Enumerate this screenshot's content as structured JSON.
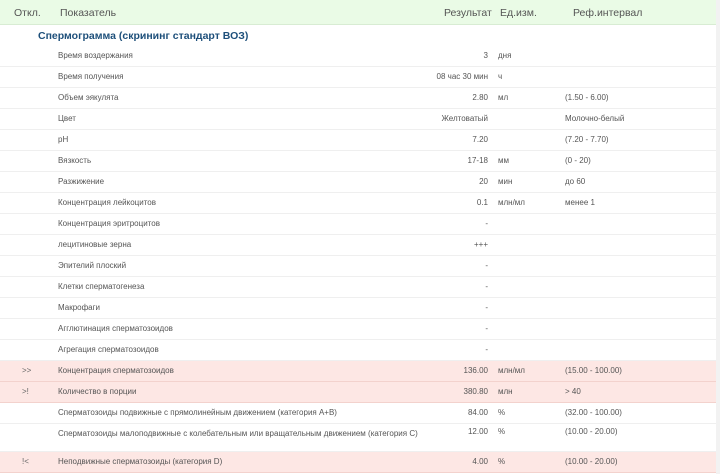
{
  "header": {
    "flag": "Откл.",
    "name": "Показатель",
    "result": "Результат",
    "unit": "Ед.изм.",
    "ref": "Реф.интервал"
  },
  "section_title": "Спермограмма (скрининг стандарт ВОЗ)",
  "rows": [
    {
      "flag": "",
      "name": "Время воздержания",
      "value": "3",
      "unit": "дня",
      "ref": ""
    },
    {
      "flag": "",
      "name": "Время получения",
      "value": "08 час 30 мин",
      "unit": "ч",
      "ref": ""
    },
    {
      "flag": "",
      "name": "Объем эякулята",
      "value": "2.80",
      "unit": "мл",
      "ref": "(1.50 - 6.00)"
    },
    {
      "flag": "",
      "name": "Цвет",
      "value": "Желтоватый",
      "unit": "",
      "ref": "Молочно-белый"
    },
    {
      "flag": "",
      "name": "pH",
      "value": "7.20",
      "unit": "",
      "ref": "(7.20 - 7.70)"
    },
    {
      "flag": "",
      "name": "Вязкость",
      "value": "17-18",
      "unit": "мм",
      "ref": "(0 - 20)"
    },
    {
      "flag": "",
      "name": "Разжижение",
      "value": "20",
      "unit": "мин",
      "ref": "до 60"
    },
    {
      "flag": "",
      "name": "Концентрация лейкоцитов",
      "value": "0.1",
      "unit": "млн/мл",
      "ref": "менее 1"
    },
    {
      "flag": "",
      "name": "Концентрация эритроцитов",
      "value": "-",
      "unit": "",
      "ref": ""
    },
    {
      "flag": "",
      "name": "лецитиновые зерна",
      "value": "+++",
      "unit": "",
      "ref": ""
    },
    {
      "flag": "",
      "name": "Эпителий плоский",
      "value": "-",
      "unit": "",
      "ref": ""
    },
    {
      "flag": "",
      "name": "Клетки сперматогенеза",
      "value": "-",
      "unit": "",
      "ref": ""
    },
    {
      "flag": "",
      "name": "Макрофаги",
      "value": "-",
      "unit": "",
      "ref": ""
    },
    {
      "flag": "",
      "name": "Агглютинация сперматозоидов",
      "value": "-",
      "unit": "",
      "ref": ""
    },
    {
      "flag": "",
      "name": "Агрегация сперматозоидов",
      "value": "-",
      "unit": "",
      "ref": ""
    },
    {
      "flag": ">>",
      "name": "Концентрация сперматозоидов",
      "value": "136.00",
      "unit": "млн/мл",
      "ref": "(15.00 - 100.00)",
      "abnormal": true
    },
    {
      "flag": ">!",
      "name": "Количество в порции",
      "value": "380.80",
      "unit": "млн",
      "ref": "> 40",
      "abnormal": true
    },
    {
      "flag": "",
      "name": "Сперматозоиды подвижные с прямолинейным движением (категория A+B)",
      "value": "84.00",
      "unit": "%",
      "ref": "(32.00 - 100.00)"
    },
    {
      "flag": "",
      "name": "Сперматозоиды малоподвижные с колебательным или вращательным движением (категория С)",
      "value": "12.00",
      "unit": "%",
      "ref": "(10.00 - 20.00)",
      "tall": true
    },
    {
      "flag": "!<",
      "name": "Неподвижные сперматозоиды (категория D)",
      "value": "4.00",
      "unit": "%",
      "ref": "(10.00 - 20.00)",
      "abnormal": true
    }
  ]
}
